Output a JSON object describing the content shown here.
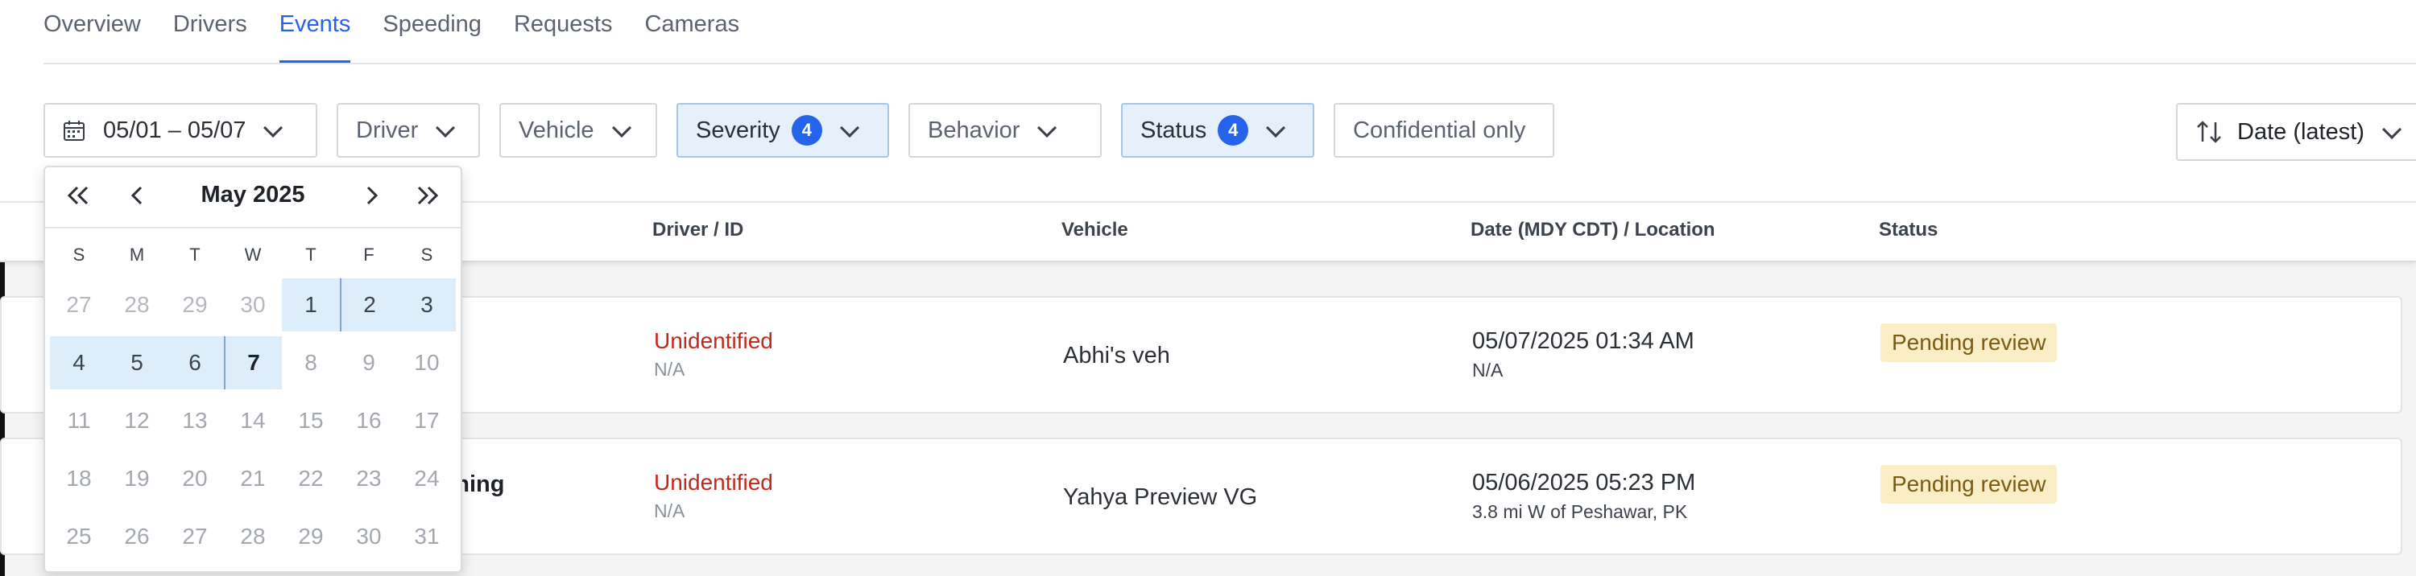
{
  "tabs": [
    "Overview",
    "Drivers",
    "Events",
    "Speeding",
    "Requests",
    "Cameras"
  ],
  "active_tab": "Events",
  "filters": {
    "date_range": "05/01 – 05/07",
    "driver": "Driver",
    "vehicle": "Vehicle",
    "severity": "Severity",
    "severity_count": "4",
    "behavior": "Behavior",
    "status": "Status",
    "status_count": "4",
    "confidential": "Confidential only"
  },
  "sort": {
    "label": "Date (latest)"
  },
  "columns": {
    "driver": "Driver / ID",
    "vehicle": "Vehicle",
    "date": "Date (MDY CDT) / Location",
    "status": "Status"
  },
  "rows": [
    {
      "event_fragment": "",
      "driver": "Unidentified",
      "driver_id": "N/A",
      "vehicle": "Abhi's veh",
      "datetime": "05/07/2025 01:34 AM",
      "location": "N/A",
      "status": "Pending review"
    },
    {
      "event_fragment": "rning",
      "driver": "Unidentified",
      "driver_id": "N/A",
      "vehicle": "Yahya Preview VG",
      "datetime": "05/06/2025 05:23 PM",
      "location": "3.8 mi W of Peshawar, PK",
      "status": "Pending review"
    }
  ],
  "calendar": {
    "title": "May 2025",
    "weekdays": [
      "S",
      "M",
      "T",
      "W",
      "T",
      "F",
      "S"
    ],
    "weeks": [
      [
        "27",
        "28",
        "29",
        "30",
        "1",
        "2",
        "3"
      ],
      [
        "4",
        "5",
        "6",
        "7",
        "8",
        "9",
        "10"
      ],
      [
        "11",
        "12",
        "13",
        "14",
        "15",
        "16",
        "17"
      ],
      [
        "18",
        "19",
        "20",
        "21",
        "22",
        "23",
        "24"
      ],
      [
        "25",
        "26",
        "27",
        "28",
        "29",
        "30",
        "31"
      ]
    ]
  },
  "colors": {
    "accent": "#2563eb",
    "range_bg": "#ddeefa",
    "error_text": "#c2281d",
    "status_bg": "#fbeec6"
  },
  "icons": [
    "calendar-icon",
    "chevron-down-icon",
    "sort-icon",
    "double-chevron-left-icon",
    "chevron-left-icon",
    "chevron-right-icon",
    "double-chevron-right-icon"
  ]
}
